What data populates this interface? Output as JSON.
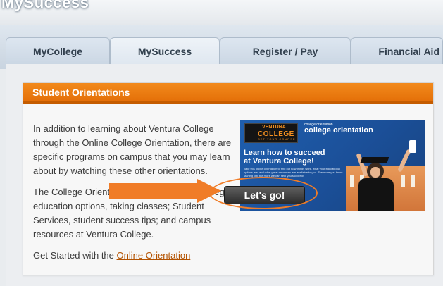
{
  "header": {
    "site_title": "MySuccess"
  },
  "tabs": [
    {
      "label": "MyCollege",
      "active": false
    },
    {
      "label": "MySuccess",
      "active": true
    },
    {
      "label": "Register / Pay",
      "active": false
    },
    {
      "label": "Financial Aid",
      "active": false
    }
  ],
  "panel": {
    "title": "Student Orientations",
    "paragraph1": "In addition to learning about Ventura College through the Online College Orientation, there are specific programs on campus that you may learn about by watching these other orientations.",
    "paragraph2": "The College Orientation covers: Ventura College education options, taking classes; Student Services, student success tips; and campus resources at Ventura College.",
    "get_started_prefix": "Get Started with the ",
    "get_started_link": "Online Orientation"
  },
  "banner": {
    "logo_top": "VENTURA",
    "logo_name": "COLLEGE",
    "logo_tagline": "SET YOUR COURSE",
    "eyebrow": "college orientation",
    "heading": "college orientation",
    "headline_line1": "Learn how to succeed",
    "headline_line2": "at Ventura College!",
    "fine_print": "Take this online orientation to find out how things work, what your educational options are, and what great resources are available to you. The more you know starting out, the more we can help you succeed!",
    "button_label": "Let's go!"
  },
  "colors": {
    "accent": "#e46f08",
    "annotation": "#f07c27",
    "banner_blue": "#1f5fae",
    "tab_bg": "#cbd7e4"
  },
  "icons": {
    "callout_arrow": "right-arrow-annotation",
    "callout_ellipse": "highlight-ellipse"
  }
}
